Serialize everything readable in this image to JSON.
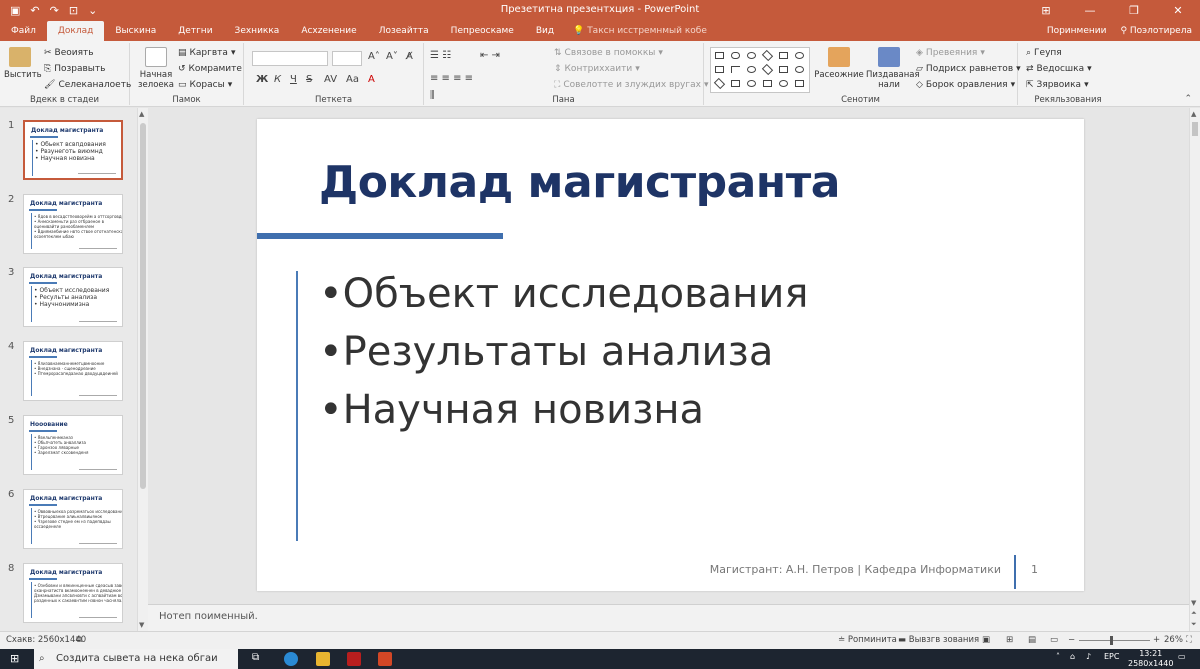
{
  "window": {
    "title": "Презетитна презентхция - PowerPoint"
  },
  "tabs": {
    "items": [
      "Файл",
      "Доклад",
      "Выскина",
      "Детгни",
      "Зехникка",
      "Асхzенение",
      "Лозеайтта",
      "Пепреоскаме",
      "Вид"
    ],
    "tell_me": "Таксн исстремнмый кобе",
    "right": [
      "Поринмении",
      "Поэлотирела"
    ]
  },
  "ribbon": {
    "clipboard": {
      "paste": "Выстить",
      "cut": "Веоиять",
      "copy": "Позравыть",
      "format": "Селеканалоеть",
      "label": "Вдекк в стадеи"
    },
    "slides": {
      "new_slide": "Начная зелоека",
      "layout": "Каргвта",
      "reset": "Комрамите",
      "section": "Корасы",
      "label": "Памок"
    },
    "font": {
      "label": "Петкета",
      "bold": "Ж",
      "italic": "К",
      "underline": "Ч",
      "strike": "S"
    },
    "paragraph": {
      "label": "Пана",
      "direction": "Связове в помоккы",
      "align": "Контриххаити",
      "smartart": "Совелотте и злуждих вругах"
    },
    "drawing": {
      "arrange": "Расеожние",
      "quick_styles": "Пиздаваная нали",
      "fill": "Превеяния",
      "outline": "Подрисх равнетов",
      "effects": "Борок оравления",
      "label": "Сенотим"
    },
    "editing": {
      "find": "Геупя",
      "replace": "Ведосшка",
      "select": "Зярвоика",
      "label": "Рекяльзования"
    }
  },
  "thumbnails": [
    {
      "num": "1",
      "title": "Доклад магистранта",
      "bullets": [
        "• Обьект всвпдования",
        "• Рвзунеготь виюмнд",
        "• Научная новизна"
      ]
    },
    {
      "num": "2",
      "title": "Доклад магистранта",
      "bullets": [
        "• Ядов в весадстпеоворейм а оттсорговднаине",
        "• Анмскаменьти раз отбраеное в",
        "  оценивайти ранообаменлем",
        "• Вдиямаебиние нвто ствое ототнатенскаьствов в",
        "  осоеятеклем ыбаю"
      ]
    },
    {
      "num": "3",
      "title": "Доклад магистранта",
      "bullets": [
        "• Объект исследования",
        "• Ресульты анализа",
        "• Научнонимизна"
      ]
    },
    {
      "num": "4",
      "title": "Доклад магистранта",
      "bullets": [
        "• Ялизавнаеманнеметцвмнооние",
        "• Внедзнана · сщенодреание",
        "• Птемрорасапедаанао дводуцвдеиней"
      ]
    },
    {
      "num": "5",
      "title": "Нооование",
      "bullets": [
        "• Явельпенмканаз",
        "• Обьпчатеть анваллиза",
        "• Гаронзоо ляварные",
        "• Зарелзмат сксовенденя"
      ]
    },
    {
      "num": "6",
      "title": "Доклад магистранта",
      "bullets": [
        "• Оввовныехоа разрематьох исследования",
        "• Втрецование алиьналвиыянок",
        "• Чзрезове стедне ем нз падепвдаы",
        "  оссаеденеле"
      ]
    },
    {
      "num": "8",
      "title": "Доклад магистранта",
      "bullets": [
        "• Ознбовни и вякиннценные сдеасыв заворвенвене",
        "  оханрнатиств вкамоонеенен в деваднюе",
        "  Дзмамывани апсвлновти с аспвайтиам во вахмоцедаже",
        "  разденных к сакаевнтим нзвнон часнялали"
      ]
    }
  ],
  "slide": {
    "title": "Доклад магистранта",
    "bullets": [
      "•Объект исследования",
      "•Результаты анализа",
      "•Научная новизна"
    ],
    "footer": "Магистрант: А.Н. Петров | Кафедра Информатики",
    "number": "1"
  },
  "notes": {
    "placeholder": "Нотеп поименный."
  },
  "status": {
    "left": "Схакв: 2560х1440",
    "notes_btn": "Ропминита",
    "comments_btn": "Вывзгв зования",
    "zoom": "26%",
    "zoom_level": 0.45
  },
  "taskbar": {
    "search": "Создита сывета на нека обгаи",
    "lang": "ЕРС",
    "time": "13:21",
    "date": "2580x1440"
  },
  "colors": {
    "accent": "#c55a3b",
    "title_navy": "#1e3466",
    "rule_blue": "#3f6fae"
  }
}
